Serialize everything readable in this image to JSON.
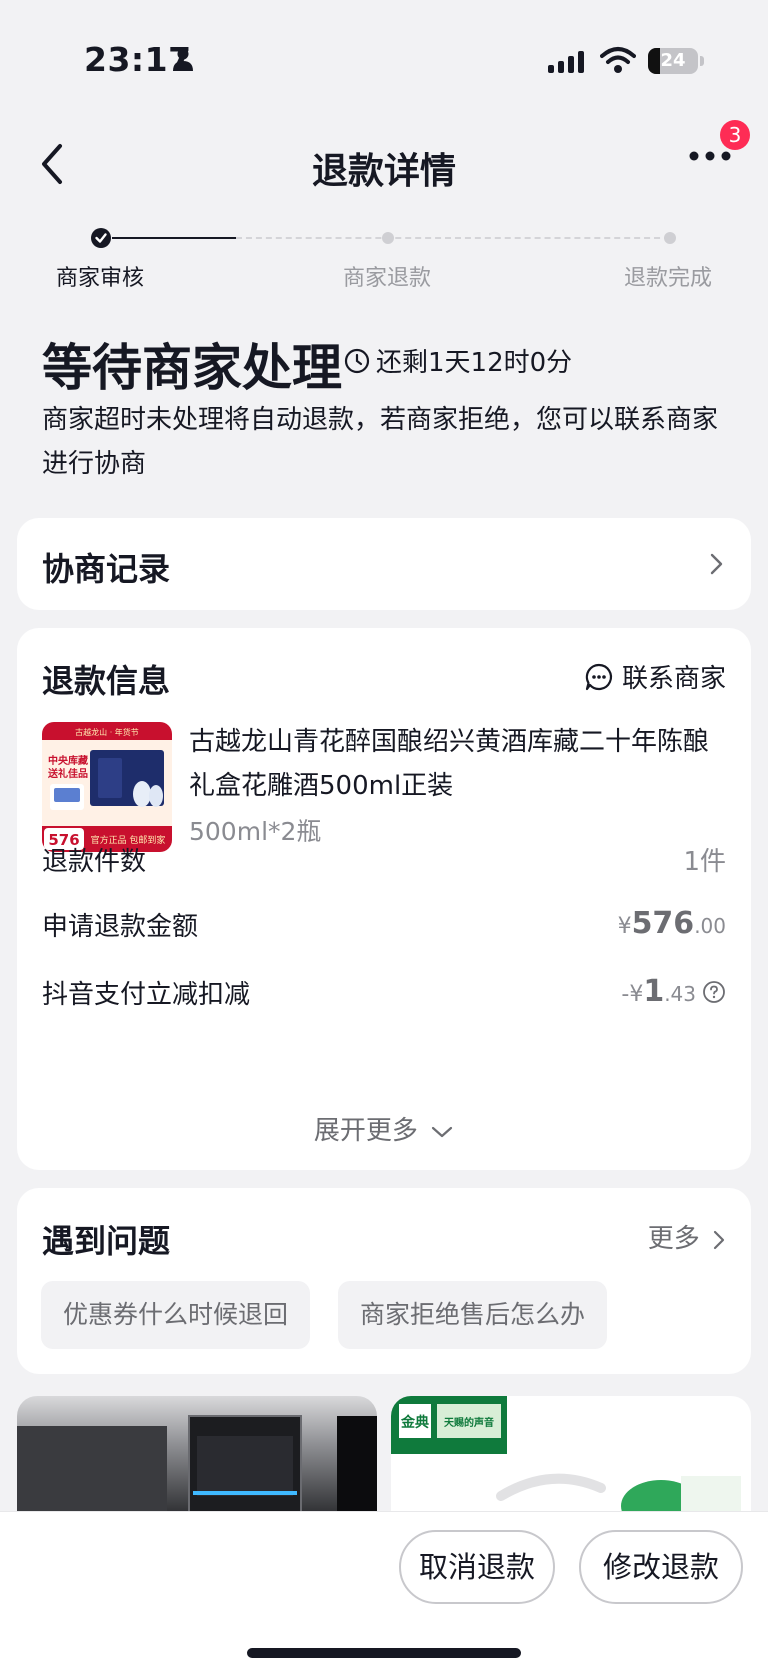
{
  "status_bar": {
    "time": "23:17",
    "battery": "24",
    "battery_level": 0.24
  },
  "nav": {
    "title": "退款详情",
    "badge_count": "3"
  },
  "steps": [
    {
      "label": "商家审核",
      "state": "done"
    },
    {
      "label": "商家退款",
      "state": "todo"
    },
    {
      "label": "退款完成",
      "state": "todo"
    }
  ],
  "status": {
    "title": "等待商家处理",
    "countdown": "还剩1天12时0分",
    "desc": "商家超时未处理将自动退款，若商家拒绝，您可以联系商家进行协商"
  },
  "negotiation": {
    "title": "协商记录"
  },
  "refund": {
    "title": "退款信息",
    "contact": "联系商家",
    "product": {
      "name": "古越龙山青花醉国酿绍兴黄酒库藏二十年陈酿礼盒花雕酒500ml正装",
      "spec": "500ml*2瓶",
      "image_texts": {
        "banner": "古越龙山 · 年货节",
        "headline1": "中央库藏",
        "headline2": "送礼佳品",
        "price": "576",
        "footer": "官方正品 包邮到家"
      }
    },
    "rows": {
      "count_label": "退款件数",
      "count_value": "1件",
      "amount_label": "申请退款金额",
      "amount_symbol": "¥",
      "amount_int": "576",
      "amount_dec": ".00",
      "discount_label": "抖音支付立减扣减",
      "discount_symbol": "-¥",
      "discount_int": "1",
      "discount_dec": ".43"
    },
    "expand": "展开更多"
  },
  "faq": {
    "title": "遇到问题",
    "more": "更多",
    "chips": [
      "优惠券什么时候退回",
      "商家拒绝售后怎么办"
    ]
  },
  "recommend": {
    "brand_label": "金典",
    "brand_sub": "天赐的声音"
  },
  "bottom": {
    "cancel": "取消退款",
    "modify": "修改退款"
  },
  "colors": {
    "accent": "#fe2c55",
    "text": "#161823",
    "muted": "#8a8b91",
    "background": "#f2f2f4"
  }
}
